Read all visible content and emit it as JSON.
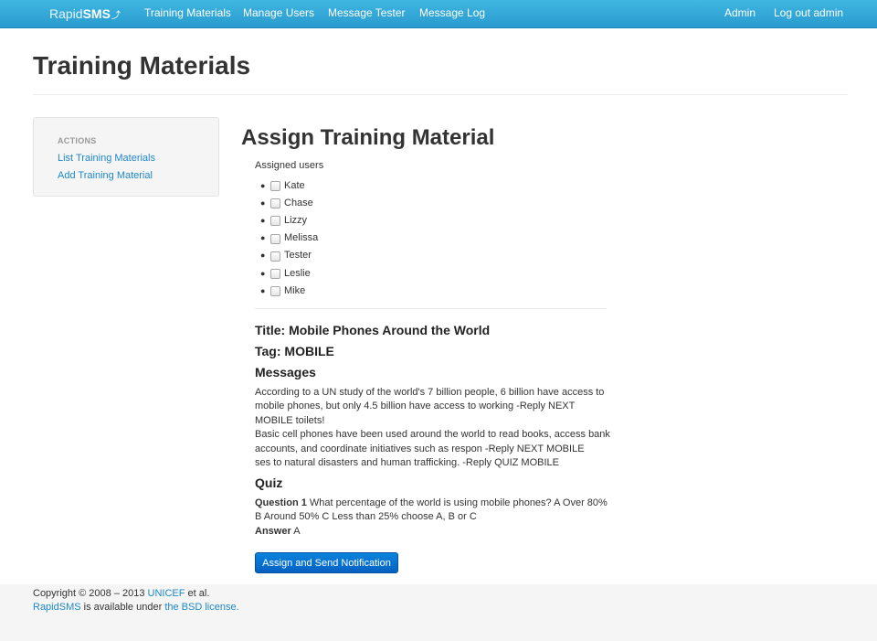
{
  "navbar": {
    "brand_prefix": "Rapid",
    "brand_suffix": "SMS",
    "links": [
      "Training Materials",
      "Manage Users",
      "Message Tester",
      "Message Log"
    ],
    "admin": "Admin",
    "logout": "Log out admin"
  },
  "page_title": "Training Materials",
  "sidebar": {
    "header": "ACTIONS",
    "links": [
      "List Training Materials",
      "Add Training Material"
    ]
  },
  "main": {
    "title": "Assign Training Material",
    "assigned_label": "Assigned users",
    "users": [
      "Kate",
      "Chase",
      "Lizzy",
      "Melissa",
      "Tester",
      "Leslie",
      "Mike"
    ],
    "title_line": "Title: Mobile Phones Around the World",
    "tag_line": "Tag: MOBILE",
    "messages_heading": "Messages",
    "messages": [
      "According to a UN study of the world's 7 billion people, 6 billion have access to mobile phones, but only 4.5 billion have access to working -Reply NEXT MOBILE toilets!",
      "Basic cell phones have been used around the world to read books, access bank accounts, and coordinate initiatives such as respon -Reply NEXT MOBILE",
      "ses to natural disasters and human trafficking. -Reply QUIZ MOBILE"
    ],
    "quiz_heading": "Quiz",
    "question_label": "Question 1",
    "question_text": " What percentage of the world is using mobile phones? A Over 80% B Around 50% C Less than 25% choose A, B or C",
    "answer_label": "Answer",
    "answer_text": " A",
    "button_label": "Assign and Send Notification"
  },
  "footer": {
    "copyright_prefix": "Copyright © 2008 – 2013 ",
    "unicef_link": "UNICEF",
    "copyright_suffix": " et al.",
    "rapidsms_link": "RapidSMS",
    "available_text": " is available under ",
    "license_link": "the BSD license."
  }
}
